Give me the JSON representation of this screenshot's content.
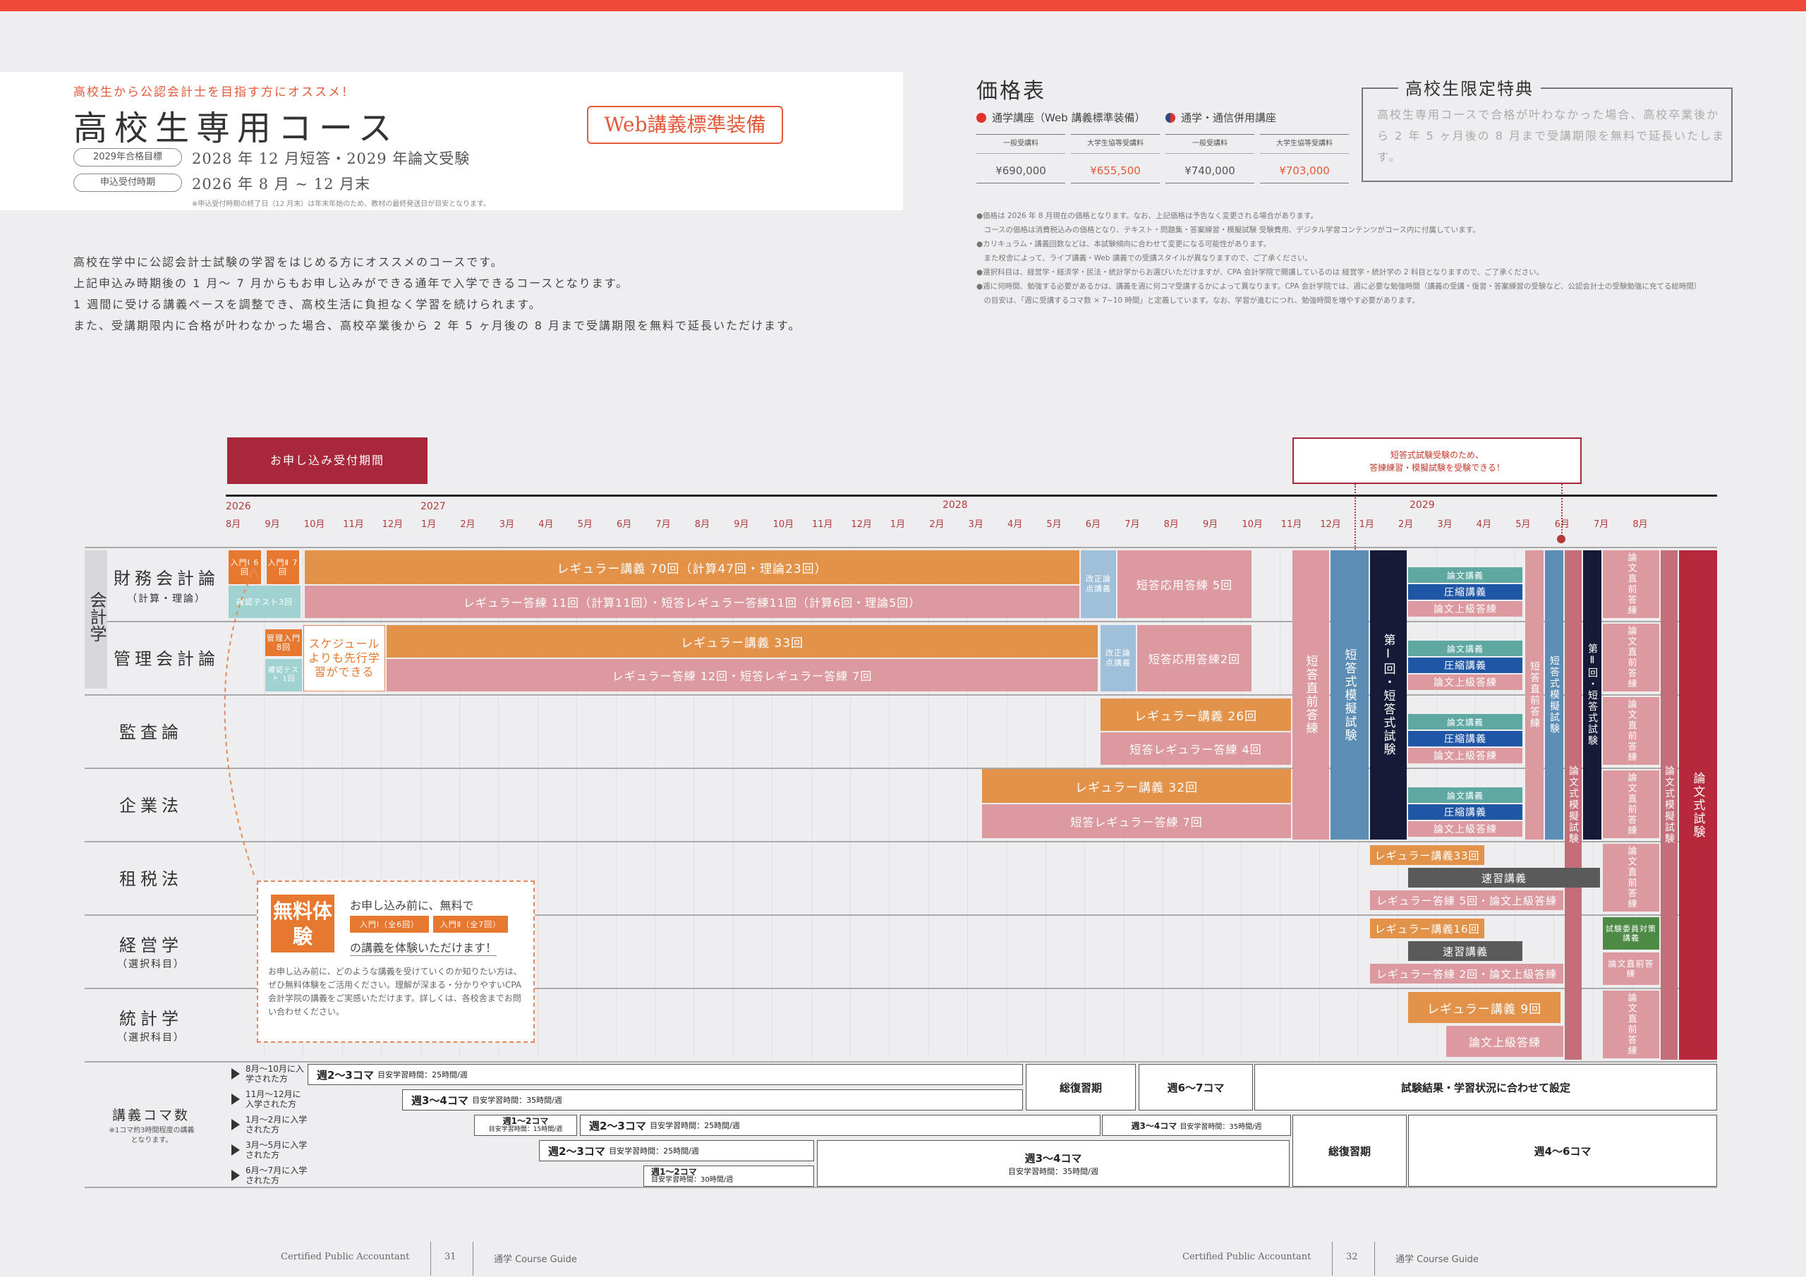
{
  "header": {
    "catch": "高校生から公認会計士を目指す方にオススメ！",
    "title": "高校生専用コース",
    "web_badge": "Web講義標準装備",
    "target_label": "2029年合格目標",
    "target_value": "2028 年 12 月短答・2029 年論文受験",
    "period_label": "申込受付時期",
    "period_value": "2026 年 8 月 ~ 12 月末",
    "note": "※申込受付時期の終了日（12 月末）は年末年始のため、教材の最終発送日が目安となります。"
  },
  "description": [
    "高校在学中に公認会計士試験の学習をはじめる方にオススメのコースです。",
    "上記申込み時期後の 1 月～ 7 月からもお申し込みができる通年で入学できるコースとなります。",
    "1 週間に受ける講義ペースを調整でき、高校生活に負担なく学習を続けられます。",
    "また、受講期限内に合格が叶わなかった場合、高校卒業後から 2 年 5 ヶ月後の 8 月まで受講期限を無料で延長いただけます。"
  ],
  "price": {
    "title": "価格表",
    "course1": "通学講座（Web 講義標準装備）",
    "course2": "通学・通信併用講座",
    "color1": "#e0322b",
    "color2": "#2a4a8a",
    "headers": [
      "一般受講料",
      "大学生協等受講料",
      "一般受講料",
      "大学生協等受講料"
    ],
    "values": [
      "¥690,000",
      "¥655,500",
      "¥740,000",
      "¥703,000"
    ],
    "notes": [
      "●価格は 2026 年 8 月現在の価格となります。なお、上記価格は予告なく変更される場合があります。",
      "　コースの価格は消費税込みの価格となり、テキスト・問題集・答案練習・模擬試験 受験費用、デジタル学習コンテンツがコース内に付属しています。",
      "●カリキュラム・講義回数などは、本試験傾向に合わせて変更になる可能性があります。",
      "　また校舎によって、ライブ講義・Web 講義での受講スタイルが異なりますので、ご了承ください。",
      "●選択科目は、経営学・経済学・民法・統計学からお選びいただけますが、CPA 会計学院で開講しているのは 経営学・統計学の 2 科目となりますので、ご了承ください。",
      "●週に何時間、勉強する必要があるかは、講義を週に何コマ受講するかによって異なります。CPA 会計学院では、週に必要な勉強時間（講義の受講・復習・答案練習の受験など、公認会計士の受験勉強に充てる総時間）",
      "　の目安は、「週に受講するコマ数 × 7~10 時間」と定義しています。なお、学習が進むにつれ、勉強時間を増やす必要があります。"
    ]
  },
  "bonus": {
    "title": "高校生限定特典",
    "text": "高校生専用コースで合格が叶わなかった場合、高校卒業後から 2 年 5 ヶ月後の 8 月まで受講期限を無料で延長いたします。"
  },
  "timeline": {
    "apply_period": "お申し込み受付期間",
    "short_note_1": "短答式試験受験のため、",
    "short_note_2": "答練練習・模擬試験を受験できる！",
    "years": [
      "2026",
      "2027",
      "2028",
      "2029"
    ],
    "months": [
      "8月",
      "9月",
      "10月",
      "11月",
      "12月",
      "1月",
      "2月",
      "3月",
      "4月",
      "5月",
      "6月",
      "7月",
      "8月",
      "9月",
      "10月",
      "11月",
      "12月",
      "1月",
      "2月",
      "3月",
      "4月",
      "5月",
      "6月",
      "7月",
      "8月",
      "9月",
      "10月",
      "11月",
      "12月",
      "1月",
      "2月",
      "3月",
      "4月",
      "5月",
      "6月",
      "7月",
      "8月"
    ]
  },
  "subjects": {
    "category": "会計学",
    "fin": "財務会計論",
    "fin_sub": "（計算・理論）",
    "mgmt": "管理会計論",
    "audit": "監査論",
    "corp": "企業法",
    "tax": "租税法",
    "econ": "経営学",
    "econ_sub": "（選択科目）",
    "stat": "統計学",
    "stat_sub": "（選択科目）",
    "sched": "講義コマ数",
    "sched_sub": "※1コマ約3時間程度の講義となります。"
  },
  "bars": {
    "intro1": "入門Ⅰ 6回",
    "intro2": "入門Ⅱ 7回",
    "check_test": "確認テスト3回",
    "fin_lecture": "レギュラー講義 70回（計算47回・理論23回）",
    "fin_drill": "レギュラー答練 11回（計算11回）・短答レギュラー答練11回（計算6回・理論5回）",
    "revise": "改正論点講義",
    "fin_short": "短答応用答練 5回",
    "mgmt_intro": "管理入門 8回",
    "mgmt_check": "確認テスト 1回",
    "schedule_adv": "スケジュールよりも先行学習ができる",
    "mgmt_lecture": "レギュラー講義 33回",
    "mgmt_drill": "レギュラー答練 12回・短答レギュラー答練 7回",
    "mgmt_short": "短答応用答練2回",
    "audit_lecture": "レギュラー講義 26回",
    "audit_drill": "短答レギュラー答練 4回",
    "corp_lecture": "レギュラー講義 32回",
    "corp_drill": "短答レギュラー答練 7回",
    "short_direct": "短答直前答練",
    "short_mock": "短答式模擬試験",
    "exam1": "第Ⅰ回・短答式試験",
    "exam2": "第Ⅱ回・短答式試験",
    "essay_drill": "論文講義",
    "compress": "圧縮講義",
    "essay_adv": "論文上級答練",
    "essay_direct": "論文直前答練",
    "essay_mock": "論文式模擬試験",
    "essay_exam": "論文式試験",
    "tax_lecture": "レギュラー講義33回",
    "speed": "速習講義",
    "tax_drill": "レギュラー答練 5回・論文上級答練",
    "econ_lecture": "レギュラー講義16回",
    "econ_drill": "レギュラー答練 2回・論文上級答練",
    "exam_committee": "試験委員対策講義",
    "stat_lecture": "レギュラー講義 9回",
    "stat_drill": "論文上級答練"
  },
  "free_trial": {
    "tag": "無料体験",
    "line1": "お申し込み前に、無料で",
    "btn1": "入門Ⅰ（全6回）",
    "btn2": "入門Ⅱ（全7回）",
    "line2": "の講義を体験いただけます！",
    "body": "お申し込み前に、どのような講義を受けていくのか知りたい方は、ぜひ無料体験をご活用ください。理解が深まる・分かりやすいCPA会計学院の講義をご実感いただけます。詳しくは、各校舎までお問い合わせください。"
  },
  "schedule": {
    "rows": [
      "8月〜10月に入学された方",
      "11月〜12月に入学された方",
      "1月〜2月に入学された方",
      "3月〜5月に入学された方",
      "6月〜7月に入学された方"
    ],
    "w23": "週2〜3コマ",
    "w34": "週3〜4コマ",
    "w12": "週1〜2コマ",
    "h25": "目安学習時間：25時間/週",
    "h35": "目安学習時間：35時間/週",
    "h15": "目安学習時間：15時間/週",
    "h30": "目安学習時間：30時間/週",
    "review": "総復習期",
    "w67": "週6〜7コマ",
    "result": "試験結果・学習状況に合わせて設定",
    "w46": "週4〜6コマ"
  },
  "footer": {
    "brand": "Certified Public Accountant",
    "page_left": "31",
    "page_right": "32",
    "guide": "通学 Course Guide"
  }
}
